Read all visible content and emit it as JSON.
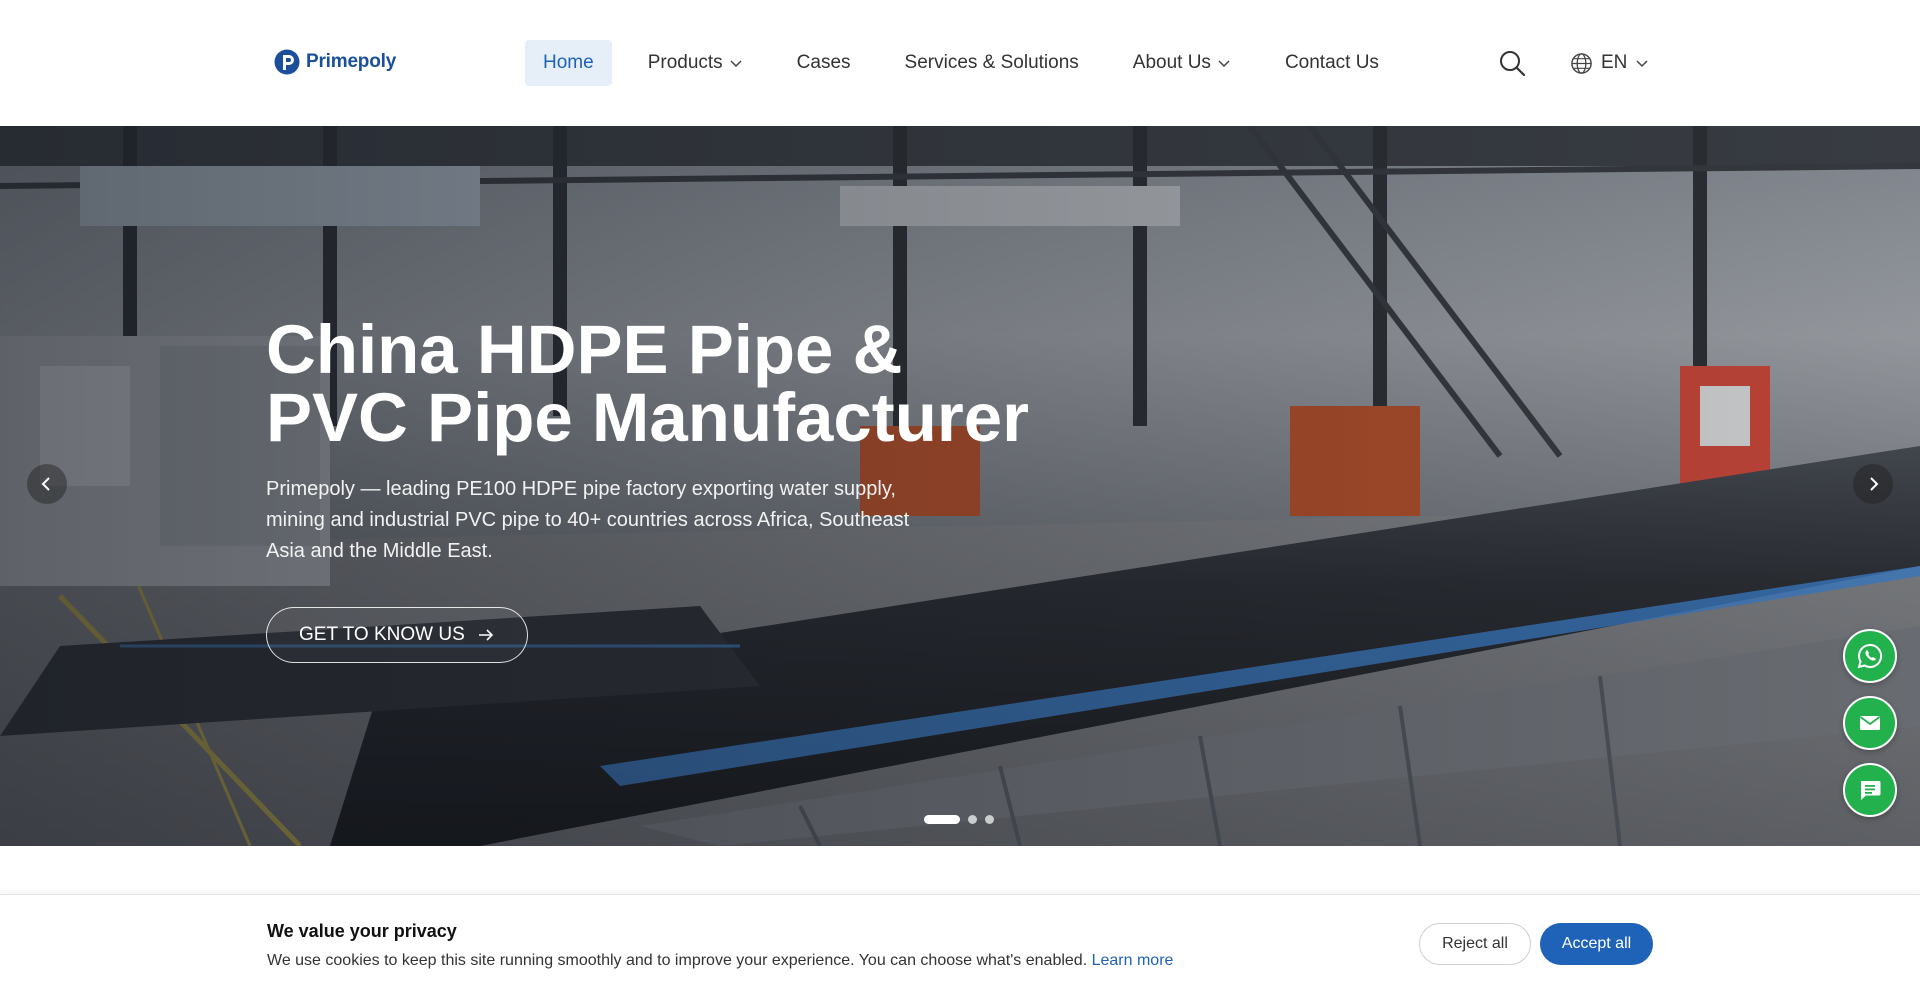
{
  "header": {
    "logo_text": "Primepoly",
    "nav": [
      {
        "label": "Home",
        "active": true,
        "has_dropdown": false
      },
      {
        "label": "Products",
        "active": false,
        "has_dropdown": true
      },
      {
        "label": "Cases",
        "active": false,
        "has_dropdown": false
      },
      {
        "label": "Services & Solutions",
        "active": false,
        "has_dropdown": false
      },
      {
        "label": "About Us",
        "active": false,
        "has_dropdown": true
      },
      {
        "label": "Contact Us",
        "active": false,
        "has_dropdown": false
      }
    ],
    "search_icon": "search-icon",
    "language": {
      "icon": "globe-icon",
      "label": "EN"
    }
  },
  "hero": {
    "title_line1": "China HDPE Pipe &",
    "title_line2": "PVC Pipe Manufacturer",
    "subtitle": "Primepoly — leading PE100 HDPE pipe factory exporting water supply, mining and industrial PVC pipe to 40+ countries across Africa, Southeast Asia and the Middle East.",
    "cta_label": "GET TO KNOW US",
    "slides_total": 3,
    "active_slide": 1
  },
  "floating": {
    "whatsapp_icon": "whatsapp-icon",
    "email_icon": "email-icon",
    "chat_icon": "chat-icon"
  },
  "cookie": {
    "title": "We value your privacy",
    "text": "We use cookies to keep this site running smoothly and to improve your experience. You can choose what's enabled.",
    "link": "Learn more",
    "reject_label": "Reject all",
    "accept_label": "Accept all"
  },
  "colors": {
    "brand": "#1b4f9c",
    "accent": "#1e63b8",
    "nav_active_bg": "#e6eef8",
    "fab_green": "#22b14c"
  }
}
